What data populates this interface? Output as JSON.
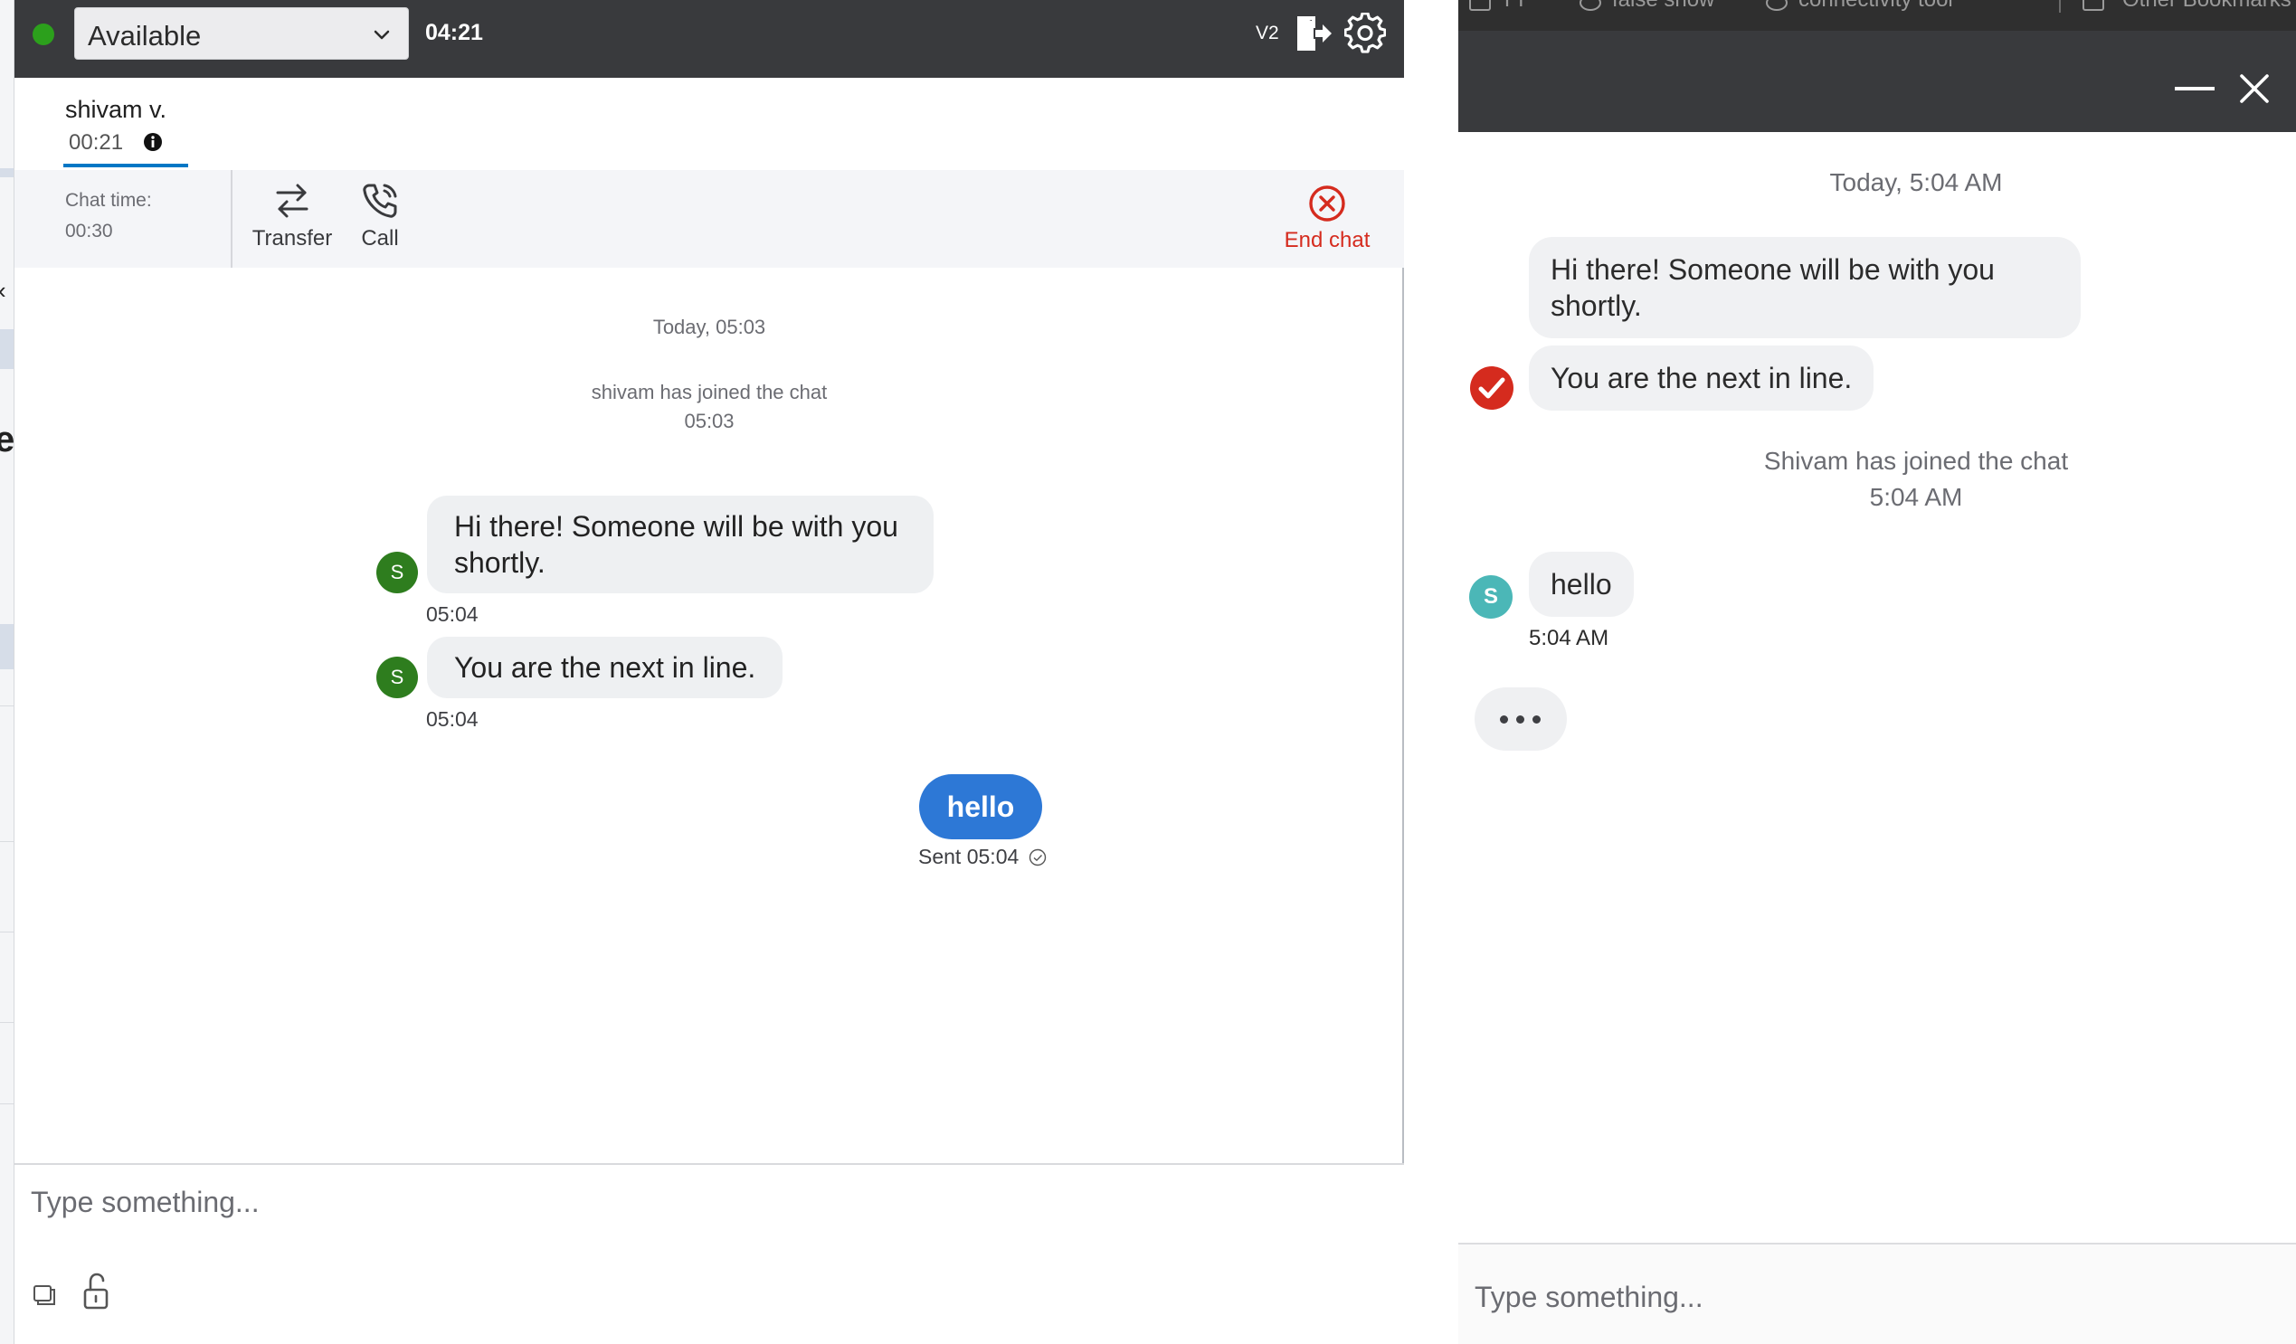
{
  "agent": {
    "status": {
      "selected": "Available",
      "color": "#2ca01c"
    },
    "session_timer": "04:21",
    "version": "V2",
    "customer": {
      "name": "shivam v.",
      "timer": "00:21"
    },
    "toolbar": {
      "chat_time_label": "Chat time:",
      "chat_time_value": "00:30",
      "transfer_label": "Transfer",
      "call_label": "Call",
      "end_chat_label": "End chat"
    },
    "conversation": {
      "date_label": "Today, 05:03",
      "join_text": "shivam has joined the chat",
      "join_time": "05:03",
      "messages_in": [
        {
          "avatar": "S",
          "text": "Hi there! Someone will be with you shortly.",
          "time": "05:04"
        },
        {
          "avatar": "S",
          "text": "You are the next in line.",
          "time": "05:04"
        }
      ],
      "message_out": {
        "text": "hello",
        "sent_label": "Sent",
        "time": "05:04"
      }
    },
    "composer": {
      "placeholder": "Type something..."
    }
  },
  "widget": {
    "bookmarks": [
      "YT",
      "false show",
      "connectivity tool",
      "Other Bookmarks"
    ],
    "date_label": "Today, 5:04 AM",
    "bot_messages": [
      "Hi there! Someone will be with you shortly.",
      "You are the next in line."
    ],
    "join_text": "Shivam has joined the chat",
    "join_time": "5:04 AM",
    "agent_message": {
      "avatar": "S",
      "text": "hello",
      "time": "5:04 AM"
    },
    "composer": {
      "placeholder": "Type something..."
    }
  },
  "colors": {
    "header": "#393a3d",
    "accent_blue": "#2d78d6",
    "tab_blue": "#0077c5",
    "end_chat_red": "#d52b1e",
    "agent_avatar_green": "#2e7d1e",
    "widget_avatar_teal": "#4bb7b7"
  }
}
